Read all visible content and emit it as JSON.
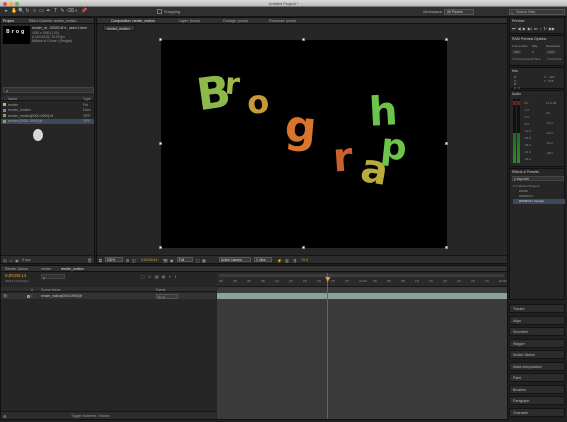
{
  "window": {
    "title": "Untitled Project *",
    "traffic_colors": [
      "#e2544a",
      "#e9b23b",
      "#5fba4b"
    ]
  },
  "toolbar": {
    "tools": [
      "▸",
      "✋",
      "🔍",
      "↻",
      "⊹",
      "▭",
      "✒",
      "T",
      "✎",
      "⌫",
      "◐",
      "📌"
    ],
    "snapping_label": "Snapping",
    "workspace_label": "Workspace:",
    "workspace_value": "All Panels",
    "search_placeholder": "Search Help"
  },
  "project_panel": {
    "tabs": [
      "Project",
      "Effect Controls: render_motion"
    ],
    "preview_name": "render_m...00000.tif ▾ , used 1 time",
    "preview_info": [
      "1920 x 1080 (1.00)",
      "Δ 0;00;01;00, 30.00 fps",
      "Millions of Colors+ (Straight)"
    ],
    "search_placeholder": "ρ",
    "columns": [
      "Name",
      "Type"
    ],
    "items": [
      {
        "name": "render",
        "type": "Fol",
        "color": "#d4b04a"
      },
      {
        "name": "render_motion",
        "type": "Com",
        "color": "#6d8fbd"
      },
      {
        "name": "render_motion[0000-0090].tif",
        "type": "TIFF",
        "color": "#7aa56e"
      },
      {
        "name": "render.[0000- 0090].tif",
        "type": "TIFF",
        "color": "#7aa56e"
      }
    ],
    "bottom_label": "8 bpc"
  },
  "composition_panel": {
    "tabs": [
      "Composition: render_motion",
      "Layer: (none)",
      "Footage: (none)",
      "Flowchart: (none)"
    ],
    "subtab": "render_motion",
    "letters": [
      {
        "text": "B",
        "color": "#8db94a"
      },
      {
        "text": "r",
        "color": "#a4b943"
      },
      {
        "text": "o",
        "color": "#c89a37"
      },
      {
        "text": "g",
        "color": "#d8752c"
      },
      {
        "text": "r",
        "color": "#c9612a"
      },
      {
        "text": "a",
        "color": "#b8ac3d"
      },
      {
        "text": "h",
        "color": "#6dc44c"
      },
      {
        "text": "p",
        "color": "#6ec44a"
      }
    ],
    "footer": {
      "zoom": "100%",
      "timecode": "0;00;00;14",
      "resolution": "Full",
      "camera": "Active Camera",
      "view": "1 View",
      "exposure": "+0.0"
    }
  },
  "right_panels": {
    "preview": {
      "title": "Preview"
    },
    "ram_preview": {
      "title": "RAM Preview Options",
      "cols": [
        "Frame Rate",
        "Skip",
        "Resolution"
      ],
      "vals": [
        "(30)",
        "0",
        "Auto"
      ],
      "from_current": "From Current Time",
      "full_screen": "Full Scre"
    },
    "info": {
      "title": "Info",
      "r": "R :",
      "g": "G :",
      "b": "B :",
      "a": "A : 0",
      "x": "X : -422",
      "y": "Y : 976"
    },
    "audio": {
      "title": "Audio",
      "levels": [
        "0.0",
        "-3.0",
        "-6.0",
        "-9.0",
        "-12.0",
        "-15.0",
        "-18.0",
        "-21.0",
        "-24.0"
      ],
      "levels_r": [
        "12.0 dB",
        "0.0",
        "-12.0",
        "-24.0",
        "-36.0",
        "-48.0"
      ]
    },
    "effects": {
      "title": "Effects & Presets",
      "search": "ρ trapcode",
      "tree": [
        "▾ ✦ Motion Plug-ins",
        "RSMB",
        "RSMB Pro",
        "RSMB Pro Vectors"
      ]
    },
    "stack": [
      "Tracker",
      "Align",
      "Smoother",
      "Wiggler",
      "Motion Sketch",
      "Mask Interpolation",
      "Paint",
      "Brushes",
      "Paragraph",
      "Character"
    ]
  },
  "timeline": {
    "tabs": [
      "Render Queue",
      "render",
      "render_motion"
    ],
    "timecode": "0;00;00;14",
    "fps_sub": "00014 (30.00 fps)",
    "search_placeholder": "ρ",
    "columns": [
      "#",
      "Source Name",
      "Parent"
    ],
    "layer": {
      "index": "1",
      "name": "render_motion[0000-0090].tif",
      "parent": "None"
    },
    "ruler": [
      "00f",
      "03f",
      "06f",
      "09f",
      "12f",
      "15f",
      "18f",
      "21f",
      "24f",
      "27f",
      "01:00f",
      "03f",
      "06f",
      "09f",
      "12f",
      "15f",
      "18f",
      "21f",
      "24f",
      "27f",
      "02:00f"
    ],
    "bottom_label": "Toggle Switches / Modes",
    "playhead_fraction": 0.38
  }
}
